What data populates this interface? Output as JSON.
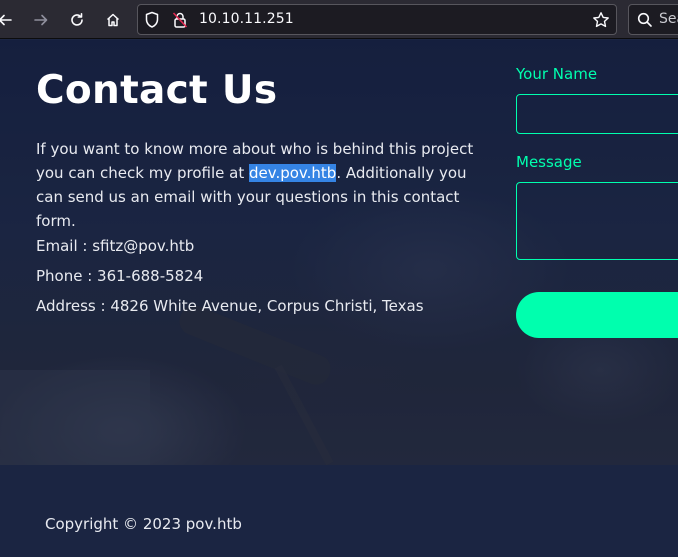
{
  "browser": {
    "url": "10.10.11.251",
    "search_placeholder": "Sea"
  },
  "contact": {
    "title": "Contact Us",
    "intro_before_link": "If you want to know more about who is behind this project you can check my profile at ",
    "link_text": "dev.pov.htb",
    "intro_after_link": ". Additionally you can send us an email with your questions in this contact form.",
    "email": "Email : sfitz@pov.htb",
    "phone": "Phone : 361-688-5824",
    "address": "Address : 4826 White Avenue, Corpus Christi, Texas"
  },
  "form": {
    "name_label": "Your Name",
    "name_value": "",
    "message_label": "Message",
    "message_value": ""
  },
  "footer": {
    "copyright": "Copyright © 2023 pov.htb"
  },
  "colors": {
    "accent": "#00ffae",
    "page_bg": "#1b2542",
    "link_highlight": "#3584e4"
  }
}
